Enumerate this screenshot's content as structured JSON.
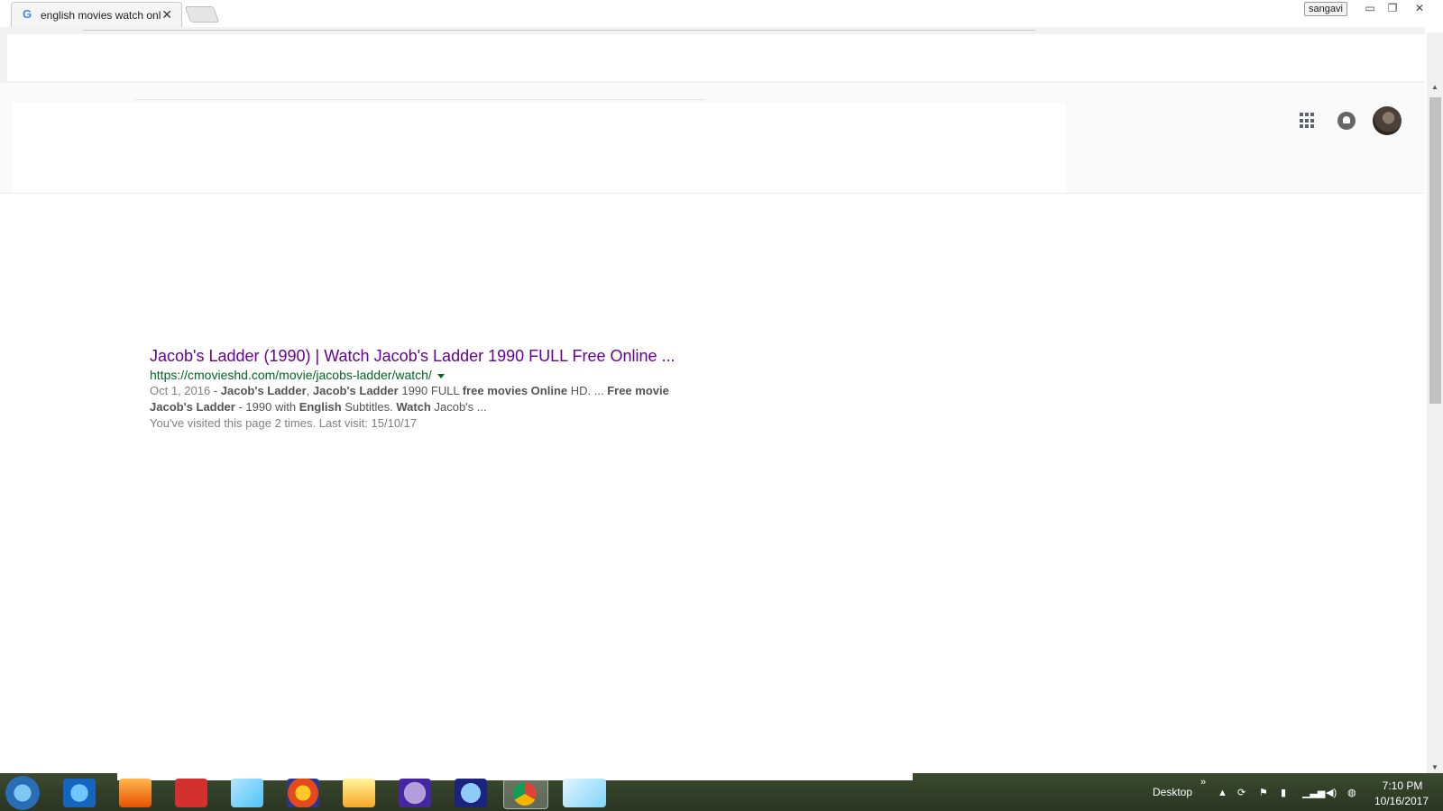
{
  "browser": {
    "tab_title": "english movies watch onl",
    "tab_favicon": "google-g-icon",
    "user_name": "sangavi"
  },
  "result": {
    "title": "Jacob's Ladder (1990) | Watch Jacob's Ladder 1990 FULL Free Online ...",
    "url": "https://cmovieshd.com/movie/jacobs-ladder/watch/",
    "date": "Oct 1, 2016",
    "snippet_parts": {
      "sep1": " - ",
      "b1": "Jacob's Ladder",
      "t1": ", ",
      "b2": "Jacob's Ladder",
      "t2": " 1990 FULL ",
      "b3": "free movies Online",
      "t3": " HD. ... ",
      "b4": "Free movie",
      "b5": "Jacob's Ladder",
      "t4": " - 1990 with ",
      "b6": "English",
      "t5": " Subtitles. ",
      "b7": "Watch",
      "t6": " Jacob's ..."
    },
    "visited": "You've visited this page 2 times. Last visit: 15/10/17"
  },
  "header_icons": [
    "apps-grid-icon",
    "notifications-icon",
    "account-avatar"
  ],
  "taskbar": {
    "apps": [
      "start-orb",
      "internet-explorer-icon",
      "media-player-icon",
      "oracle-icon",
      "notepad-icon",
      "firefox-icon",
      "file-explorer-icon",
      "pidgin-icon",
      "thunderbird-icon",
      "chrome-icon",
      "paint-icon"
    ],
    "desktop_label": "Desktop",
    "chevron": "»",
    "time": "7:10 PM",
    "date": "10/16/2017"
  },
  "colors": {
    "visited_link": "#660099",
    "url_green": "#006621",
    "snippet_gray": "#545454"
  }
}
